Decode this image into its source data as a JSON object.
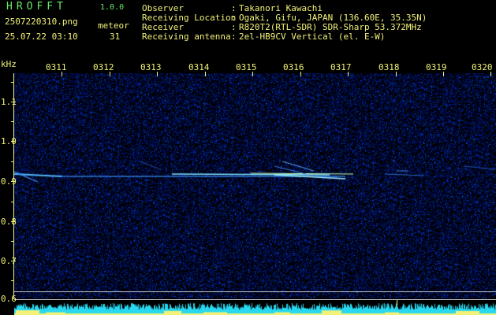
{
  "app": {
    "title": "HROFFT",
    "version": "1.0.0",
    "file_name": "2507220310.png",
    "timestamp": "25.07.22 03:10",
    "meteor_label": "meteor",
    "meteor_count": "31"
  },
  "info": [
    {
      "label": "Observer",
      "value": "Takanori Kawachi"
    },
    {
      "label": "Receiving Location",
      "value": "Ogaki, Gifu, JAPAN (136.60E, 35.35N)"
    },
    {
      "label": "Receiver",
      "value": "R820T2(RTL-SDR) SDR-Sharp 53.372MHz"
    },
    {
      "label": "Receiving antenna",
      "value": "2el-HB9CV Vertical (el. E-W)"
    }
  ],
  "axis": {
    "unit": "kHz",
    "time_ticks": [
      "0311",
      "0312",
      "0313",
      "0314",
      "0315",
      "0316",
      "0317",
      "0318",
      "0319",
      "0320"
    ],
    "freq_ticks": [
      "1.1",
      "1.0",
      "0.9",
      "0.8",
      "0.7"
    ],
    "bottom_label": "0.6"
  },
  "colors": {
    "background": "#000000",
    "noise": "#0a1a6e",
    "signal": "#9fe8ff",
    "labels": "#f2f27a",
    "title": "#68e868"
  }
}
